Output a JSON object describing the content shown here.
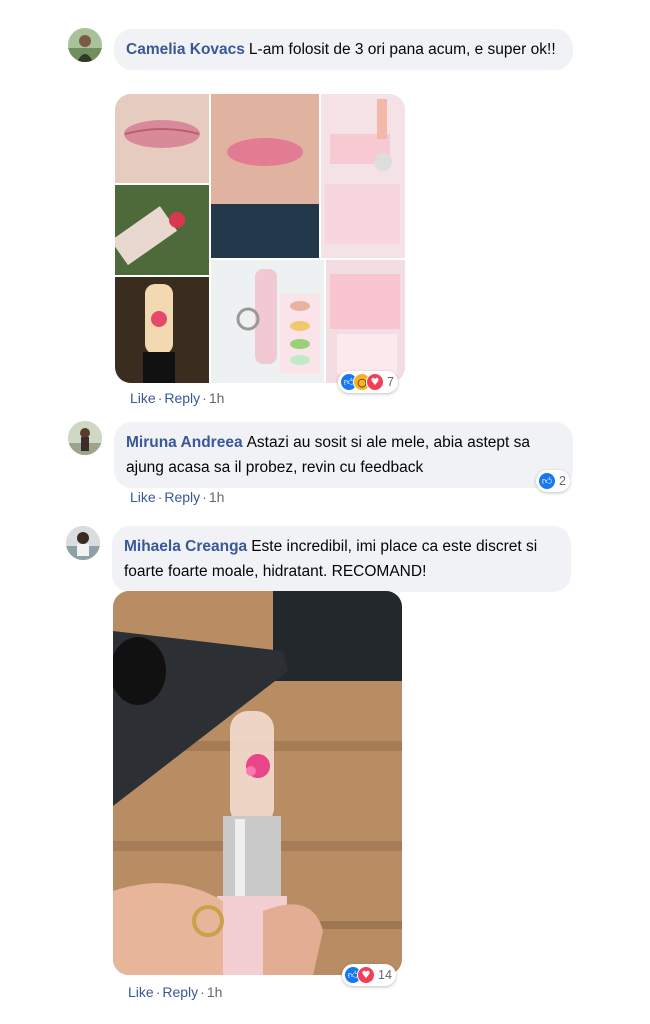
{
  "comments": [
    {
      "author": "Camelia Kovacs",
      "text": "L-am folosit de 3 ori pana acum, e super ok!!",
      "reaction_count": "7",
      "reactions": [
        "like-icon",
        "wow-icon",
        "love-icon"
      ],
      "actions": {
        "like": "Like",
        "reply": "Reply",
        "time": "1h"
      }
    },
    {
      "author": "Miruna Andreea",
      "text": "Astazi au sosit si ale mele, abia astept sa ajung acasa sa il probez, revin cu feedback",
      "reaction_count": "2",
      "reactions": [
        "like-icon"
      ],
      "actions": {
        "like": "Like",
        "reply": "Reply",
        "time": "1h"
      }
    },
    {
      "author": "Mihaela Creanga",
      "text": "Este incredibil, imi place ca este discret si foarte foarte moale, hidratant. RECOMAND!",
      "reaction_count": "14",
      "reactions": [
        "like-icon",
        "love-icon"
      ],
      "actions": {
        "like": "Like",
        "reply": "Reply",
        "time": "1h"
      }
    }
  ],
  "colors": {
    "author": "#385898",
    "bubble": "#f0f2f5",
    "meta": "#65676b",
    "like": "#1877f2",
    "love": "#f33e58",
    "wow": "#f7b125"
  }
}
